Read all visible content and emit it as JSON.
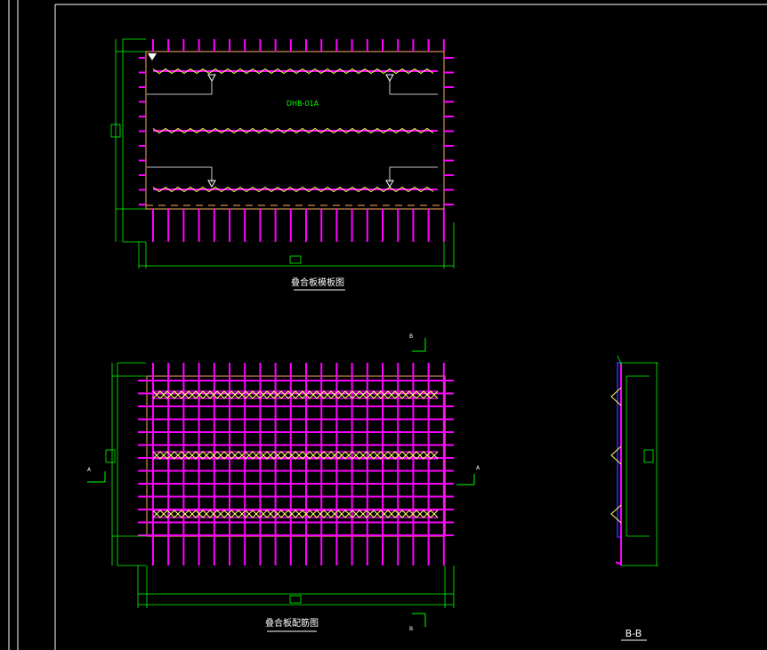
{
  "colors": {
    "background": "#000000",
    "frame": "#ffffff",
    "rebar": "#ff00ff",
    "truss": "#ffff66",
    "outline": "#ffaa66",
    "dimension": "#00ff00",
    "text_green": "#00ff00",
    "text_white": "#ffffff",
    "bb_plate": "#3333ff"
  },
  "top_view": {
    "panel_label": "DHB-01A",
    "caption": "叠合板模板图"
  },
  "bottom_view": {
    "caption": "叠合板配筋图",
    "section_mark_b": "B",
    "section_mark_a": "A"
  },
  "section_view": {
    "caption": "B-B"
  }
}
